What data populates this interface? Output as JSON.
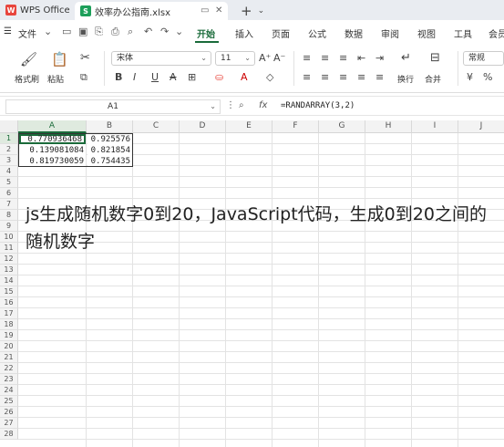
{
  "titlebar": {
    "app_tab": "WPS Office",
    "file_tab": "效率办公指南.xlsx",
    "new_tab_icon": "plus-icon"
  },
  "menubar": {
    "file_menu": "文件",
    "tabs": [
      "开始",
      "插入",
      "页面",
      "公式",
      "数据",
      "审阅",
      "视图",
      "工具",
      "会员"
    ],
    "active_tab": "开始"
  },
  "ribbon": {
    "format_painter": "格式刷",
    "paste": "粘贴",
    "font_name": "宋体",
    "font_size": "11",
    "wrap": "换行",
    "merge": "合并",
    "number_format": "常规"
  },
  "formula_bar": {
    "name_box": "A1",
    "formula": "=RANDARRAY(3,2)"
  },
  "grid": {
    "columns": [
      "A",
      "B",
      "C",
      "D",
      "E",
      "F",
      "G",
      "H",
      "I",
      "J"
    ],
    "rows": [
      "1",
      "2",
      "3",
      "4",
      "5",
      "6",
      "7",
      "8",
      "9",
      "10",
      "11",
      "12",
      "13",
      "14",
      "15",
      "16",
      "17",
      "18",
      "19",
      "20",
      "21",
      "22",
      "23",
      "24",
      "25",
      "26",
      "27",
      "28"
    ],
    "cells": [
      [
        "0.770936468",
        "0.925576"
      ],
      [
        "0.139081084",
        "0.821854"
      ],
      [
        "0.819730059",
        "0.754435"
      ]
    ]
  },
  "overlay_text": "js生成随机数字0到20，JavaScript代码，生成0到20之间的随机数字",
  "colors": {
    "accent": "#1a6b3a",
    "wps_red": "#e8453c",
    "xls_green": "#1d9f5a"
  }
}
